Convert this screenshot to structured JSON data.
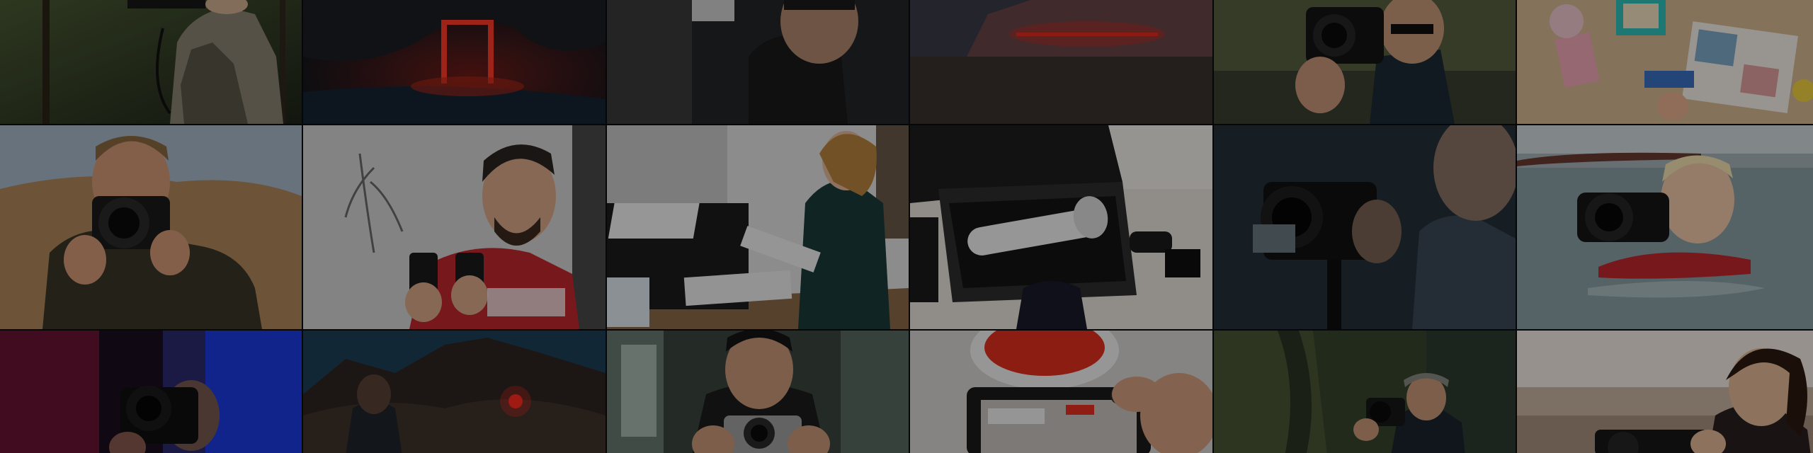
{
  "mosaic": {
    "tiles": [
      {
        "name": "photo-hunter-forest-camera",
        "colors": [
          "#3c4a2a",
          "#2a2f22"
        ]
      },
      {
        "name": "photo-red-neon-arch-cave",
        "colors": [
          "#1c2630",
          "#e0281e"
        ]
      },
      {
        "name": "photo-man-portrait-closeup",
        "colors": [
          "#2a2a2c",
          "#c8a084"
        ]
      },
      {
        "name": "photo-red-laser-rock-beach",
        "colors": [
          "#4a3a3c",
          "#e4312a"
        ]
      },
      {
        "name": "photo-man-sunglasses-camera",
        "colors": [
          "#4a5236",
          "#1e2630"
        ]
      },
      {
        "name": "photo-scrapbook-desk-flatlay",
        "colors": [
          "#d8b890",
          "#f2d6b4"
        ]
      },
      {
        "name": "photo-man-mountain-camera",
        "colors": [
          "#c9a27a",
          "#4a4232"
        ]
      },
      {
        "name": "photo-presenter-camera-red-shirt",
        "colors": [
          "#dcdcdc",
          "#c0282e"
        ]
      },
      {
        "name": "photo-woman-printer-office",
        "colors": [
          "#e4e4e4",
          "#1a3a3a"
        ]
      },
      {
        "name": "photo-telephoto-lens-case",
        "colors": [
          "#e8e2d8",
          "#1a1a1a"
        ]
      },
      {
        "name": "photo-man-camera-dark-room",
        "colors": [
          "#2c3a40",
          "#111418"
        ]
      },
      {
        "name": "photo-photographer-in-lake",
        "colors": [
          "#9fb2b8",
          "#f4d2b2"
        ]
      },
      {
        "name": "photo-photographer-red-blue-light",
        "colors": [
          "#7a1438",
          "#2050ff"
        ]
      },
      {
        "name": "photo-night-mountain-red-light",
        "colors": [
          "#1e3a4a",
          "#3a2a24"
        ]
      },
      {
        "name": "photo-man-car-compact-camera",
        "colors": [
          "#4a5650",
          "#1a1a1a"
        ]
      },
      {
        "name": "photo-coffee-cup-camera-screen",
        "colors": [
          "#d8d6d2",
          "#e23220"
        ]
      },
      {
        "name": "photo-man-cap-forest-camera",
        "colors": [
          "#3e4a34",
          "#1c2228"
        ]
      },
      {
        "name": "photo-woman-beach-camera",
        "colors": [
          "#f0e6d8",
          "#2a1a12"
        ]
      }
    ]
  }
}
